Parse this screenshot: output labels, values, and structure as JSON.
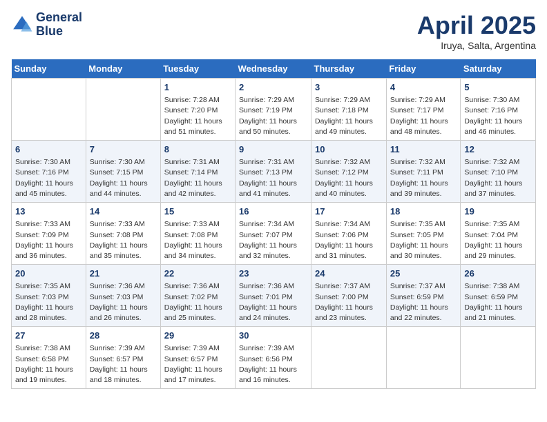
{
  "header": {
    "logo_line1": "General",
    "logo_line2": "Blue",
    "title": "April 2025",
    "subtitle": "Iruya, Salta, Argentina"
  },
  "weekdays": [
    "Sunday",
    "Monday",
    "Tuesday",
    "Wednesday",
    "Thursday",
    "Friday",
    "Saturday"
  ],
  "weeks": [
    [
      {
        "day": "",
        "info": ""
      },
      {
        "day": "",
        "info": ""
      },
      {
        "day": "1",
        "info": "Sunrise: 7:28 AM\nSunset: 7:20 PM\nDaylight: 11 hours and 51 minutes."
      },
      {
        "day": "2",
        "info": "Sunrise: 7:29 AM\nSunset: 7:19 PM\nDaylight: 11 hours and 50 minutes."
      },
      {
        "day": "3",
        "info": "Sunrise: 7:29 AM\nSunset: 7:18 PM\nDaylight: 11 hours and 49 minutes."
      },
      {
        "day": "4",
        "info": "Sunrise: 7:29 AM\nSunset: 7:17 PM\nDaylight: 11 hours and 48 minutes."
      },
      {
        "day": "5",
        "info": "Sunrise: 7:30 AM\nSunset: 7:16 PM\nDaylight: 11 hours and 46 minutes."
      }
    ],
    [
      {
        "day": "6",
        "info": "Sunrise: 7:30 AM\nSunset: 7:16 PM\nDaylight: 11 hours and 45 minutes."
      },
      {
        "day": "7",
        "info": "Sunrise: 7:30 AM\nSunset: 7:15 PM\nDaylight: 11 hours and 44 minutes."
      },
      {
        "day": "8",
        "info": "Sunrise: 7:31 AM\nSunset: 7:14 PM\nDaylight: 11 hours and 42 minutes."
      },
      {
        "day": "9",
        "info": "Sunrise: 7:31 AM\nSunset: 7:13 PM\nDaylight: 11 hours and 41 minutes."
      },
      {
        "day": "10",
        "info": "Sunrise: 7:32 AM\nSunset: 7:12 PM\nDaylight: 11 hours and 40 minutes."
      },
      {
        "day": "11",
        "info": "Sunrise: 7:32 AM\nSunset: 7:11 PM\nDaylight: 11 hours and 39 minutes."
      },
      {
        "day": "12",
        "info": "Sunrise: 7:32 AM\nSunset: 7:10 PM\nDaylight: 11 hours and 37 minutes."
      }
    ],
    [
      {
        "day": "13",
        "info": "Sunrise: 7:33 AM\nSunset: 7:09 PM\nDaylight: 11 hours and 36 minutes."
      },
      {
        "day": "14",
        "info": "Sunrise: 7:33 AM\nSunset: 7:08 PM\nDaylight: 11 hours and 35 minutes."
      },
      {
        "day": "15",
        "info": "Sunrise: 7:33 AM\nSunset: 7:08 PM\nDaylight: 11 hours and 34 minutes."
      },
      {
        "day": "16",
        "info": "Sunrise: 7:34 AM\nSunset: 7:07 PM\nDaylight: 11 hours and 32 minutes."
      },
      {
        "day": "17",
        "info": "Sunrise: 7:34 AM\nSunset: 7:06 PM\nDaylight: 11 hours and 31 minutes."
      },
      {
        "day": "18",
        "info": "Sunrise: 7:35 AM\nSunset: 7:05 PM\nDaylight: 11 hours and 30 minutes."
      },
      {
        "day": "19",
        "info": "Sunrise: 7:35 AM\nSunset: 7:04 PM\nDaylight: 11 hours and 29 minutes."
      }
    ],
    [
      {
        "day": "20",
        "info": "Sunrise: 7:35 AM\nSunset: 7:03 PM\nDaylight: 11 hours and 28 minutes."
      },
      {
        "day": "21",
        "info": "Sunrise: 7:36 AM\nSunset: 7:03 PM\nDaylight: 11 hours and 26 minutes."
      },
      {
        "day": "22",
        "info": "Sunrise: 7:36 AM\nSunset: 7:02 PM\nDaylight: 11 hours and 25 minutes."
      },
      {
        "day": "23",
        "info": "Sunrise: 7:36 AM\nSunset: 7:01 PM\nDaylight: 11 hours and 24 minutes."
      },
      {
        "day": "24",
        "info": "Sunrise: 7:37 AM\nSunset: 7:00 PM\nDaylight: 11 hours and 23 minutes."
      },
      {
        "day": "25",
        "info": "Sunrise: 7:37 AM\nSunset: 6:59 PM\nDaylight: 11 hours and 22 minutes."
      },
      {
        "day": "26",
        "info": "Sunrise: 7:38 AM\nSunset: 6:59 PM\nDaylight: 11 hours and 21 minutes."
      }
    ],
    [
      {
        "day": "27",
        "info": "Sunrise: 7:38 AM\nSunset: 6:58 PM\nDaylight: 11 hours and 19 minutes."
      },
      {
        "day": "28",
        "info": "Sunrise: 7:39 AM\nSunset: 6:57 PM\nDaylight: 11 hours and 18 minutes."
      },
      {
        "day": "29",
        "info": "Sunrise: 7:39 AM\nSunset: 6:57 PM\nDaylight: 11 hours and 17 minutes."
      },
      {
        "day": "30",
        "info": "Sunrise: 7:39 AM\nSunset: 6:56 PM\nDaylight: 11 hours and 16 minutes."
      },
      {
        "day": "",
        "info": ""
      },
      {
        "day": "",
        "info": ""
      },
      {
        "day": "",
        "info": ""
      }
    ]
  ]
}
